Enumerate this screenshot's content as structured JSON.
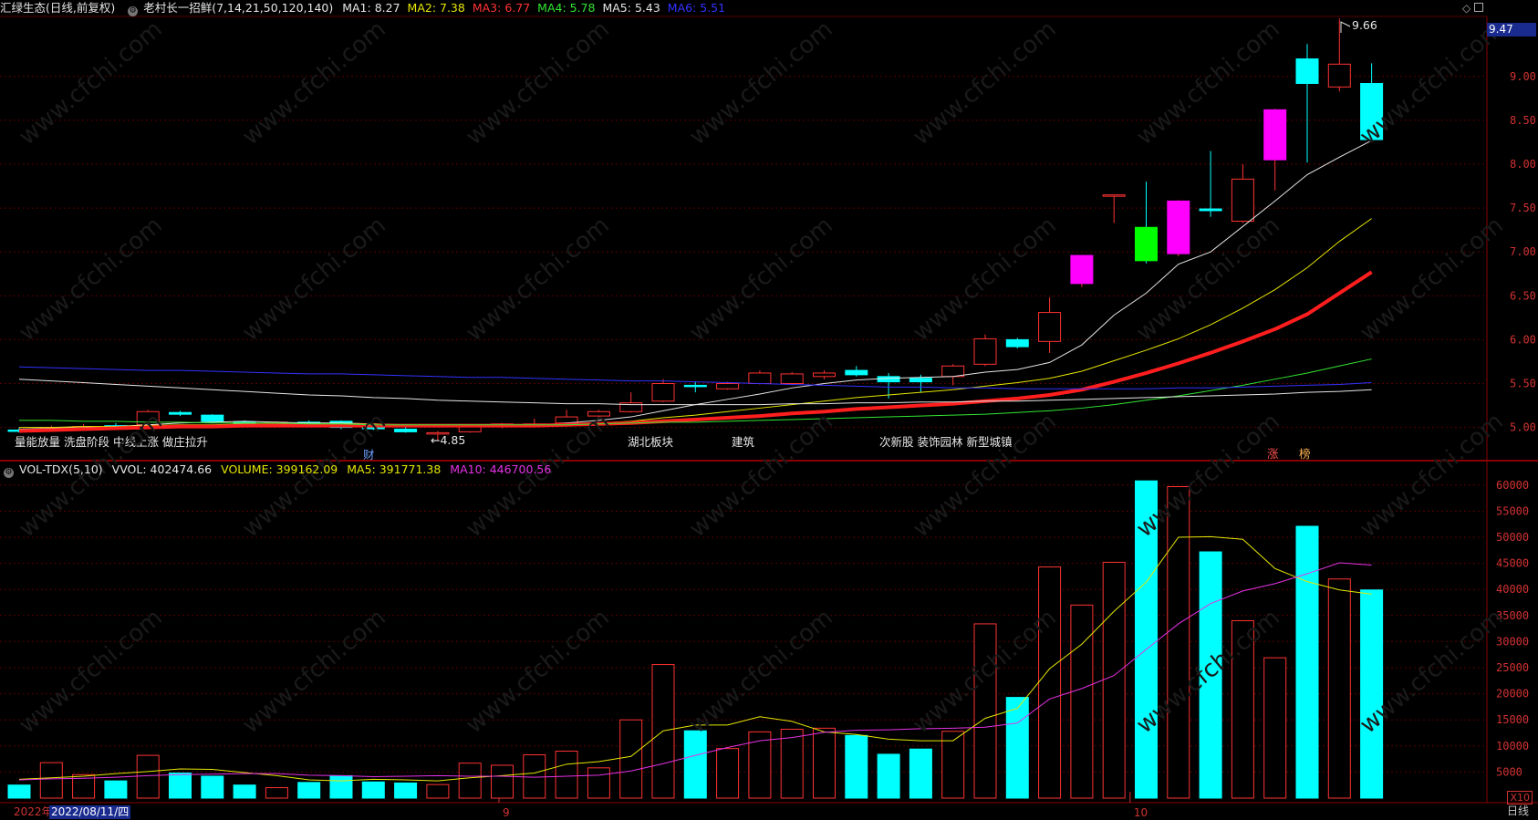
{
  "header": {
    "stock": "汇绿生态(日线,前复权)",
    "indicator": "老村长一招鲜(7,14,21,50,120,140)",
    "ma": [
      {
        "label": "MA1:",
        "value": "8.27",
        "color": "#e6e6e6"
      },
      {
        "label": "MA2:",
        "value": "7.38",
        "color": "#e6e600"
      },
      {
        "label": "MA3:",
        "value": "6.77",
        "color": "#ff3232"
      },
      {
        "label": "MA4:",
        "value": "5.78",
        "color": "#32e632"
      },
      {
        "label": "MA5:",
        "value": "5.43",
        "color": "#e6e6e6"
      },
      {
        "label": "MA6:",
        "value": "5.51",
        "color": "#3232ff"
      }
    ]
  },
  "vol_header": {
    "name": "VOL-TDX(5,10)",
    "vvol": "VVOL: 402474.66",
    "volume": "VOLUME: 399162.09",
    "ma5": "MA5: 391771.38",
    "ma10": "MA10: 446700.56"
  },
  "annotations": {
    "phase": "量能放量 洗盘阶段 中线上涨 做庄拉升",
    "low": "←4.85",
    "high": "9.66",
    "cai": "财",
    "sector1": "湖北板块",
    "sector2": "建筑",
    "sector3": "次新股 装饰园林 新型城镇",
    "zhang": "涨",
    "bang": "榜"
  },
  "price_badge": "9.47",
  "day_label": "日线",
  "year_label": "2022年",
  "date_badge": "2022/08/11/四",
  "month_labels": [
    "9",
    "10"
  ],
  "x10": "X10",
  "price_axis": [
    "9.00",
    "8.50",
    "8.00",
    "7.50",
    "7.00",
    "6.50",
    "6.00",
    "5.50",
    "5.00"
  ],
  "vol_axis": [
    "60000",
    "55000",
    "50000",
    "45000",
    "40000",
    "35000",
    "30000",
    "25000",
    "20000",
    "15000",
    "10000",
    "5000"
  ],
  "colors": {
    "up": "#ff3232",
    "down": "#00ffff",
    "grid": "#5a0000",
    "background": "#000000"
  },
  "chart_data": {
    "type": "candlestick",
    "candles": [
      {
        "o": 4.97,
        "h": 5.0,
        "l": 4.94,
        "c": 4.96
      },
      {
        "o": 4.99,
        "h": 5.02,
        "l": 4.96,
        "c": 5.0
      },
      {
        "o": 5.01,
        "h": 5.04,
        "l": 4.98,
        "c": 5.01
      },
      {
        "o": 5.02,
        "h": 5.05,
        "l": 5.0,
        "c": 5.01
      },
      {
        "o": 5.03,
        "h": 5.2,
        "l": 5.02,
        "c": 5.18
      },
      {
        "o": 5.17,
        "h": 5.19,
        "l": 5.13,
        "c": 5.15
      },
      {
        "o": 5.14,
        "h": 5.15,
        "l": 5.05,
        "c": 5.07
      },
      {
        "o": 5.06,
        "h": 5.08,
        "l": 5.02,
        "c": 5.04
      },
      {
        "o": 5.03,
        "h": 5.07,
        "l": 5.02,
        "c": 5.06
      },
      {
        "o": 5.06,
        "h": 5.08,
        "l": 5.03,
        "c": 5.05
      },
      {
        "o": 5.07,
        "h": 5.08,
        "l": 4.98,
        "c": 5.0
      },
      {
        "o": 5.0,
        "h": 5.02,
        "l": 4.97,
        "c": 4.99
      },
      {
        "o": 4.98,
        "h": 5.0,
        "l": 4.94,
        "c": 4.95
      },
      {
        "o": 4.93,
        "h": 4.96,
        "l": 4.85,
        "c": 4.94
      },
      {
        "o": 4.95,
        "h": 5.04,
        "l": 4.94,
        "c": 5.03
      },
      {
        "o": 5.02,
        "h": 5.05,
        "l": 4.99,
        "c": 5.04
      },
      {
        "o": 5.03,
        "h": 5.1,
        "l": 5.0,
        "c": 5.04
      },
      {
        "o": 5.05,
        "h": 5.2,
        "l": 5.04,
        "c": 5.12
      },
      {
        "o": 5.13,
        "h": 5.2,
        "l": 5.12,
        "c": 5.18
      },
      {
        "o": 5.18,
        "h": 5.4,
        "l": 5.17,
        "c": 5.28
      },
      {
        "o": 5.3,
        "h": 5.55,
        "l": 5.29,
        "c": 5.5
      },
      {
        "o": 5.48,
        "h": 5.52,
        "l": 5.4,
        "c": 5.47
      },
      {
        "o": 5.44,
        "h": 5.52,
        "l": 5.43,
        "c": 5.5
      },
      {
        "o": 5.5,
        "h": 5.65,
        "l": 5.49,
        "c": 5.62
      },
      {
        "o": 5.5,
        "h": 5.63,
        "l": 5.48,
        "c": 5.61
      },
      {
        "o": 5.58,
        "h": 5.65,
        "l": 5.55,
        "c": 5.62
      },
      {
        "o": 5.65,
        "h": 5.7,
        "l": 5.58,
        "c": 5.6
      },
      {
        "o": 5.58,
        "h": 5.62,
        "l": 5.33,
        "c": 5.52
      },
      {
        "o": 5.56,
        "h": 5.6,
        "l": 5.4,
        "c": 5.52
      },
      {
        "o": 5.58,
        "h": 5.72,
        "l": 5.48,
        "c": 5.7
      },
      {
        "o": 5.72,
        "h": 6.06,
        "l": 5.7,
        "c": 6.01
      },
      {
        "o": 6.0,
        "h": 6.02,
        "l": 5.9,
        "c": 5.92
      },
      {
        "o": 5.98,
        "h": 6.48,
        "l": 5.85,
        "c": 6.31
      },
      {
        "o": 6.64,
        "h": 6.96,
        "l": 6.6,
        "c": 6.96
      },
      {
        "o": 7.65,
        "h": 7.65,
        "l": 7.33,
        "c": 7.65
      },
      {
        "o": 7.28,
        "h": 7.8,
        "l": 6.87,
        "c": 6.9
      },
      {
        "o": 6.98,
        "h": 7.59,
        "l": 6.95,
        "c": 7.58
      },
      {
        "o": 7.49,
        "h": 8.15,
        "l": 7.4,
        "c": 7.47
      },
      {
        "o": 7.35,
        "h": 8.0,
        "l": 7.33,
        "c": 7.83
      },
      {
        "o": 8.05,
        "h": 8.63,
        "l": 7.7,
        "c": 8.62
      },
      {
        "o": 9.2,
        "h": 9.37,
        "l": 8.02,
        "c": 8.92
      },
      {
        "o": 8.88,
        "h": 9.66,
        "l": 8.83,
        "c": 9.14
      },
      {
        "o": 8.92,
        "h": 9.15,
        "l": 8.27,
        "c": 8.28
      }
    ],
    "volume": [
      2500,
      6800,
      4500,
      3300,
      8200,
      4800,
      4200,
      2500,
      2000,
      3000,
      4300,
      3100,
      2900,
      2600,
      6700,
      6300,
      8300,
      9000,
      5800,
      15000,
      25600,
      12900,
      9500,
      12700,
      13200,
      13400,
      12000,
      8400,
      9400,
      12800,
      33400,
      19300,
      44300,
      37000,
      45200,
      60800,
      59700,
      47200,
      34000,
      26900,
      52100,
      42000,
      39900
    ],
    "ma_series": {
      "MA1": [
        4.98,
        4.99,
        5.0,
        5.01,
        5.03,
        5.05,
        5.06,
        5.07,
        5.06,
        5.05,
        5.05,
        5.04,
        5.03,
        5.02,
        5.01,
        5.01,
        5.02,
        5.05,
        5.08,
        5.12,
        5.19,
        5.26,
        5.32,
        5.38,
        5.45,
        5.5,
        5.54,
        5.56,
        5.57,
        5.58,
        5.63,
        5.66,
        5.74,
        5.94,
        6.28,
        6.53,
        6.86,
        7.0,
        7.29,
        7.58,
        7.88,
        8.08,
        8.27
      ],
      "MA2": [
        5.0,
        5.0,
        5.01,
        5.01,
        5.02,
        5.03,
        5.03,
        5.04,
        5.04,
        5.04,
        5.04,
        5.04,
        5.03,
        5.03,
        5.03,
        5.02,
        5.03,
        5.04,
        5.05,
        5.07,
        5.11,
        5.14,
        5.18,
        5.22,
        5.26,
        5.3,
        5.34,
        5.37,
        5.4,
        5.43,
        5.47,
        5.51,
        5.56,
        5.64,
        5.76,
        5.88,
        6.01,
        6.17,
        6.36,
        6.57,
        6.82,
        7.12,
        7.38
      ],
      "MA3": [
        4.96,
        4.97,
        4.98,
        4.99,
        5.0,
        5.01,
        5.01,
        5.02,
        5.02,
        5.02,
        5.02,
        5.02,
        5.02,
        5.02,
        5.02,
        5.02,
        5.02,
        5.03,
        5.04,
        5.05,
        5.07,
        5.09,
        5.11,
        5.13,
        5.16,
        5.18,
        5.21,
        5.23,
        5.25,
        5.27,
        5.3,
        5.33,
        5.37,
        5.43,
        5.52,
        5.62,
        5.73,
        5.85,
        5.98,
        6.12,
        6.29,
        6.53,
        6.77
      ],
      "MA4": [
        5.08,
        5.08,
        5.07,
        5.07,
        5.06,
        5.06,
        5.05,
        5.05,
        5.05,
        5.04,
        5.04,
        5.03,
        5.03,
        5.03,
        5.03,
        5.03,
        5.03,
        5.03,
        5.04,
        5.05,
        5.06,
        5.06,
        5.07,
        5.08,
        5.09,
        5.1,
        5.11,
        5.12,
        5.13,
        5.14,
        5.15,
        5.17,
        5.19,
        5.22,
        5.26,
        5.31,
        5.36,
        5.42,
        5.48,
        5.55,
        5.62,
        5.7,
        5.78
      ],
      "MA5": [
        5.55,
        5.53,
        5.51,
        5.49,
        5.47,
        5.45,
        5.43,
        5.41,
        5.39,
        5.37,
        5.36,
        5.34,
        5.33,
        5.31,
        5.3,
        5.29,
        5.28,
        5.27,
        5.27,
        5.26,
        5.26,
        5.26,
        5.26,
        5.26,
        5.27,
        5.27,
        5.28,
        5.28,
        5.29,
        5.29,
        5.3,
        5.3,
        5.31,
        5.32,
        5.33,
        5.34,
        5.35,
        5.36,
        5.37,
        5.38,
        5.4,
        5.41,
        5.43
      ],
      "MA6": [
        5.69,
        5.68,
        5.67,
        5.66,
        5.65,
        5.65,
        5.64,
        5.63,
        5.62,
        5.61,
        5.61,
        5.6,
        5.59,
        5.58,
        5.57,
        5.57,
        5.56,
        5.55,
        5.54,
        5.53,
        5.53,
        5.52,
        5.51,
        5.5,
        5.49,
        5.48,
        5.47,
        5.46,
        5.46,
        5.45,
        5.45,
        5.44,
        5.44,
        5.44,
        5.44,
        5.44,
        5.45,
        5.45,
        5.46,
        5.47,
        5.48,
        5.49,
        5.51
      ]
    },
    "vol_ma5": [
      3600,
      3900,
      4200,
      4700,
      5100,
      5600,
      5500,
      4900,
      4300,
      3500,
      3300,
      3600,
      3500,
      3300,
      3900,
      4300,
      4800,
      6500,
      7000,
      8000,
      12900,
      14000,
      14000,
      15600,
      14700,
      12700,
      12200,
      11300,
      11000,
      11000,
      15300,
      17200,
      24800,
      29500,
      35800,
      41400,
      50000,
      50100,
      49600,
      44000,
      41500,
      39900,
      39100
    ],
    "vol_ma10": [
      3500,
      3700,
      3800,
      4000,
      4300,
      4500,
      4600,
      4700,
      4700,
      4400,
      4300,
      4100,
      4200,
      4300,
      4200,
      4200,
      4000,
      4200,
      4400,
      5200,
      6600,
      8200,
      9700,
      11000,
      11600,
      12600,
      13000,
      13100,
      13300,
      13400,
      13600,
      14400,
      19000,
      21000,
      23500,
      28500,
      33400,
      37300,
      39700,
      41100,
      43000,
      45100,
      44670
    ]
  }
}
